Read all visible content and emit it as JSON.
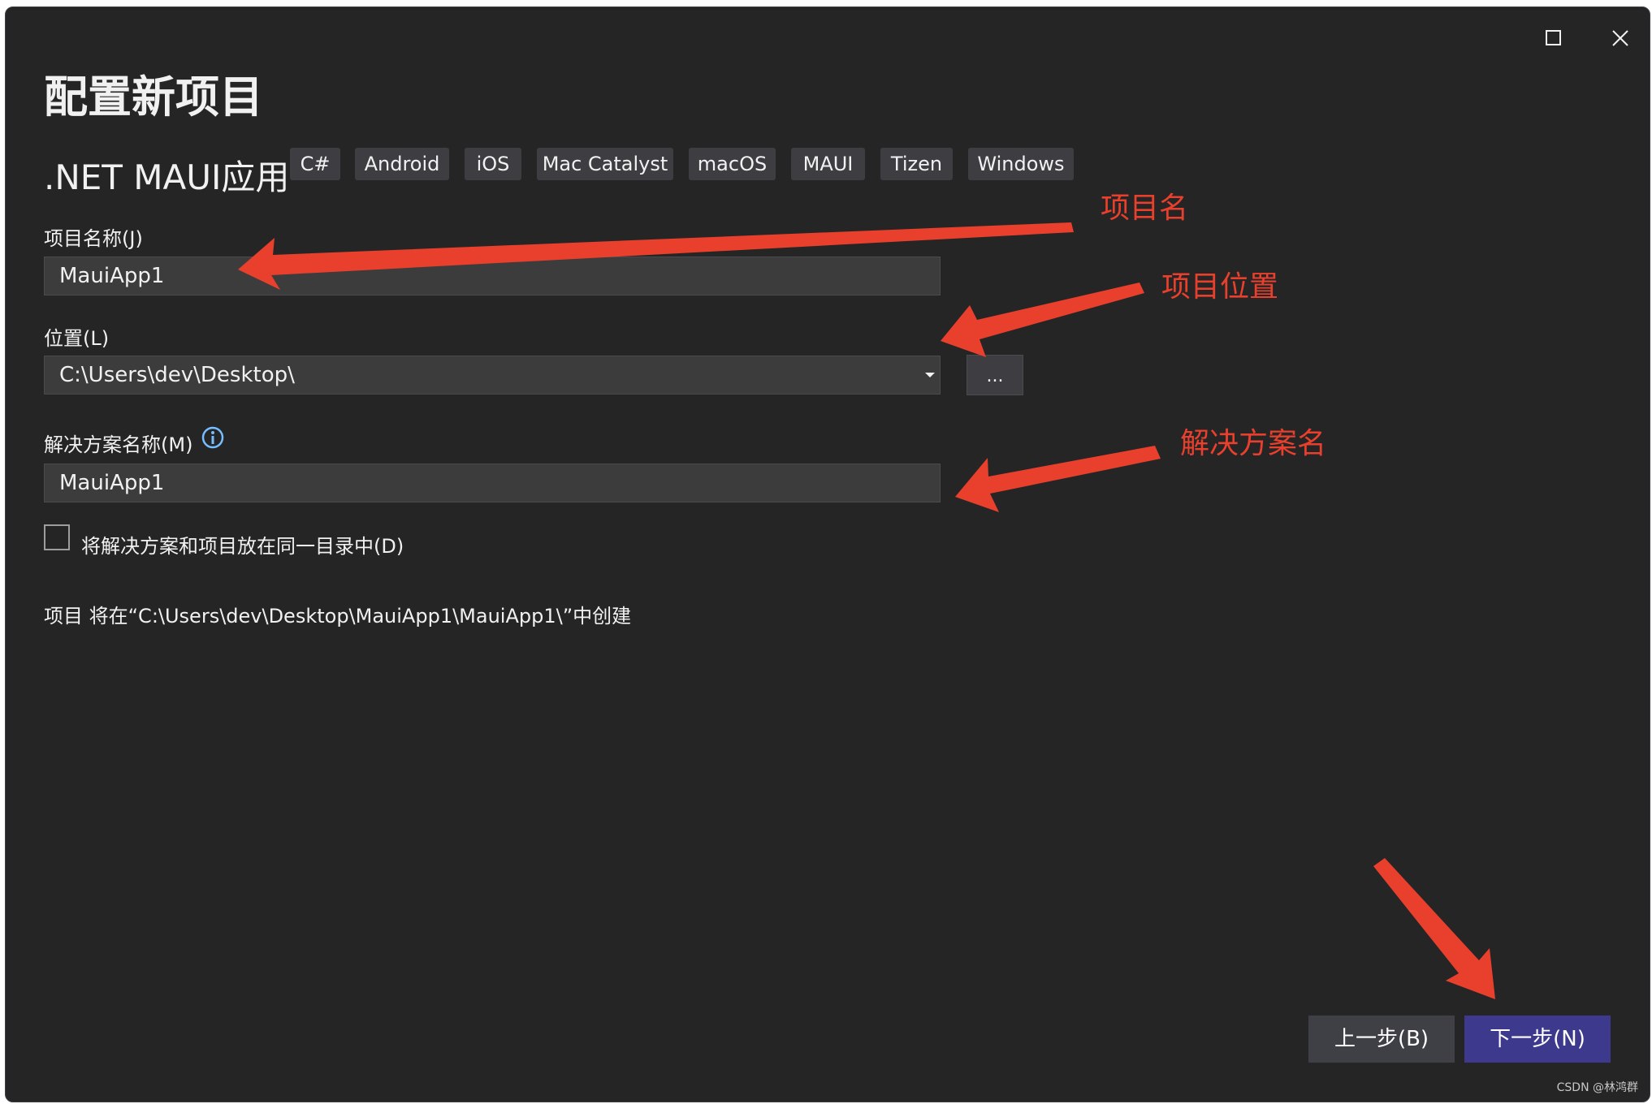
{
  "window": {
    "title": "配置新项目",
    "template_name": ".NET MAUI应用",
    "tags": [
      "C#",
      "Android",
      "iOS",
      "Mac Catalyst",
      "macOS",
      "MAUI",
      "Tizen",
      "Windows"
    ]
  },
  "form": {
    "project_name_label": "项目名称(J)",
    "project_name_value": "MauiApp1",
    "location_label": "位置(L)",
    "location_value": "C:\\Users\\dev\\Desktop\\",
    "browse_label": "...",
    "solution_name_label": "解决方案名称(M)",
    "solution_name_value": "MauiApp1",
    "same_dir_label": "将解决方案和项目放在同一目录中(D)",
    "same_dir_checked": false,
    "path_info": "项目 将在“C:\\Users\\dev\\Desktop\\MauiApp1\\MauiApp1\\”中创建"
  },
  "annotations": {
    "project_name": "项目名",
    "project_location": "项目位置",
    "solution_name": "解决方案名"
  },
  "buttons": {
    "back": "上一步(B)",
    "next": "下一步(N)"
  },
  "watermark": "CSDN @林鸿群",
  "colors": {
    "background": "#252526",
    "annotation": "#e8402d",
    "primary_button": "#3d3a8e"
  }
}
